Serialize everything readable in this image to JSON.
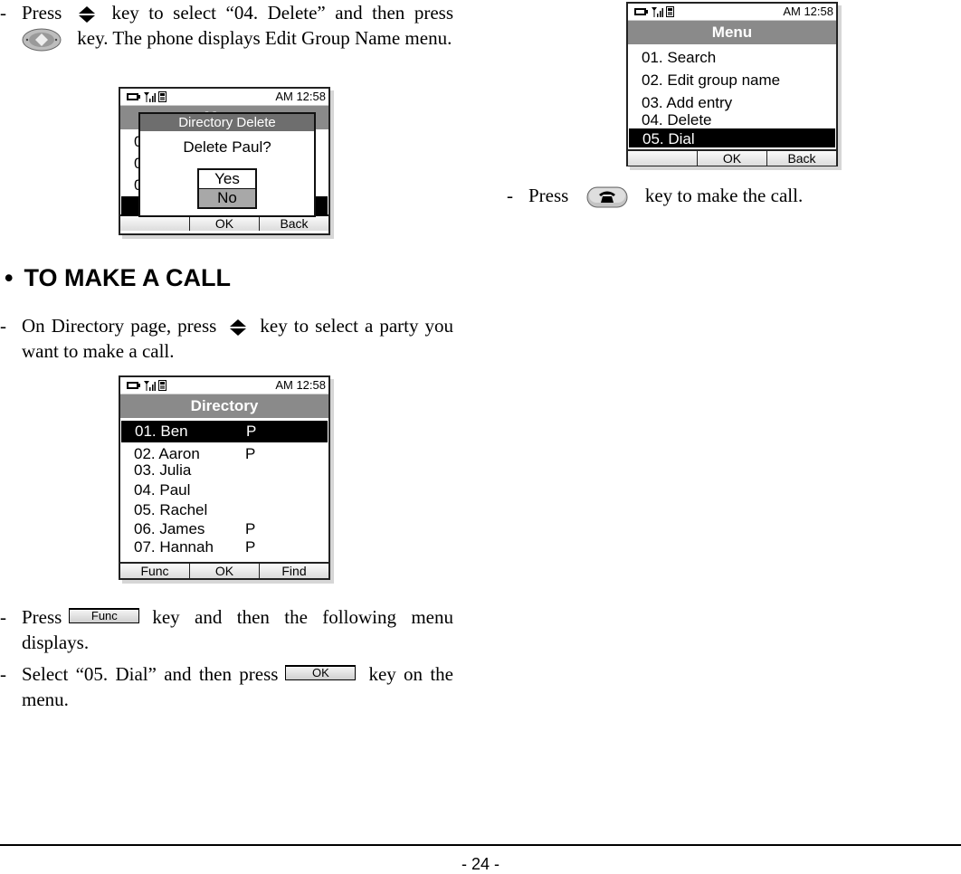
{
  "intro": {
    "line1_a": "Press",
    "line1_b": "key to select “04. Delete” and then press",
    "line2": "key. The phone displays Edit Group Name menu.",
    "up_down_key_icon": "up-down-arrow-icon",
    "nav_key_icon": "navigation-key-icon"
  },
  "delete_screen": {
    "time": "AM 12:58",
    "title": "Menu",
    "dialog_title": "Directory Delete",
    "dialog_message": "Delete Paul?",
    "options": [
      "Yes",
      "No"
    ],
    "selected_option": "No",
    "softkeys": [
      "",
      "OK",
      "Back"
    ]
  },
  "section": {
    "bullet": "•",
    "heading": "TO MAKE A CALL"
  },
  "step1": {
    "text_a": "On Directory page, press",
    "text_b": "key to select a party you want to make a call."
  },
  "directory_screen": {
    "time": "AM 12:58",
    "title": "Directory",
    "entries": [
      {
        "label": "01. Ben",
        "flag": "P",
        "selected": true
      },
      {
        "label": "02. Aaron",
        "flag": "P"
      },
      {
        "label": "03. Julia",
        "flag": ""
      },
      {
        "label": "04. Paul",
        "flag": ""
      },
      {
        "label": "05. Rachel",
        "flag": ""
      },
      {
        "label": "06. James",
        "flag": "P"
      },
      {
        "label": "07. Hannah",
        "flag": "P"
      }
    ],
    "softkeys": [
      "Func",
      "OK",
      "Find"
    ]
  },
  "step2": {
    "text_a": "Press",
    "key_label": "Func",
    "text_b": "key and then the following menu displays."
  },
  "step3": {
    "text_a": "Select “05. Dial” and then press",
    "key_label": "OK",
    "text_b": "key on the menu."
  },
  "menu_screen": {
    "time": "AM 12:58",
    "title": "Menu",
    "items": [
      "01. Search",
      "02. Edit group name",
      "03. Add entry",
      "04. Delete",
      "05. Dial"
    ],
    "selected_index": 4,
    "softkeys": [
      "",
      "OK",
      "Back"
    ]
  },
  "step4": {
    "text_a": "Press",
    "text_b": "key to make the call.",
    "key_icon": "call-key-icon"
  },
  "footer": {
    "page_number": "- 24 -"
  },
  "colors": {
    "title_bar": "#8a8a8a",
    "selection": "#000000",
    "dialog_no": "#a8a8a8"
  }
}
